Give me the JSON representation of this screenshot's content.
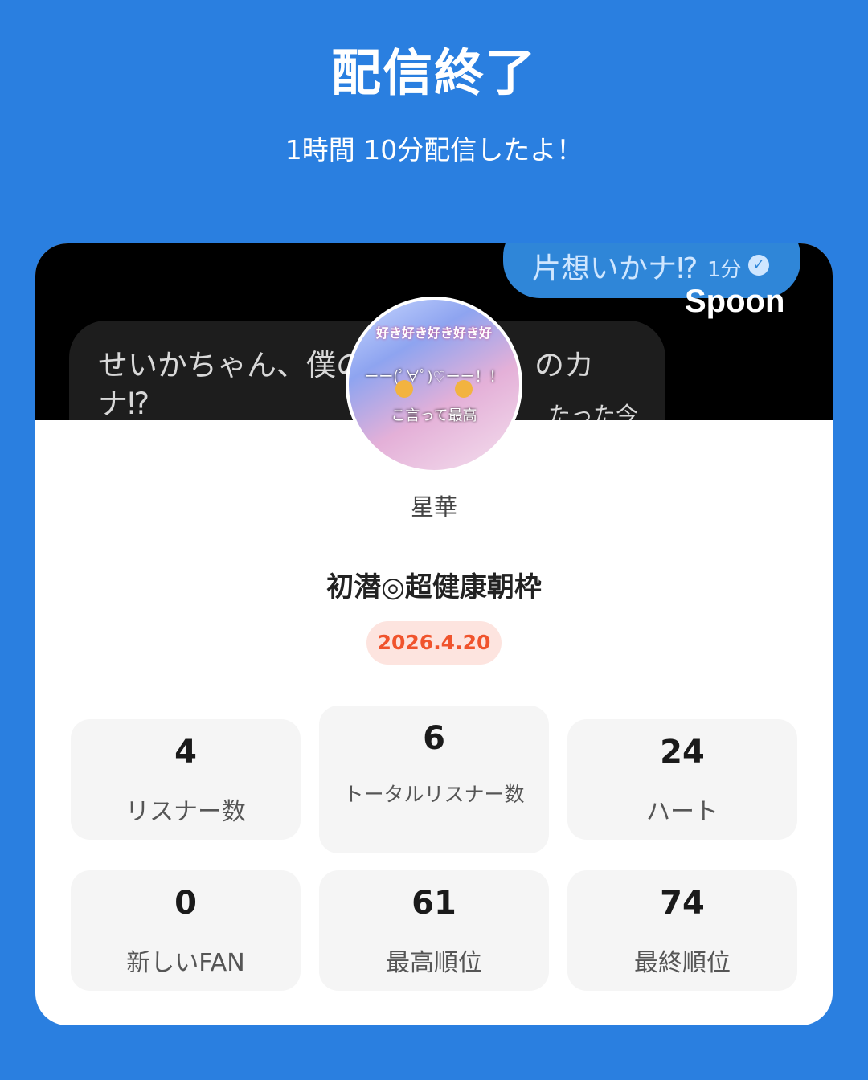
{
  "header": {
    "title": "配信終了",
    "subtitle": "1時間 10分配信したよ！"
  },
  "banner": {
    "bubble_right_text": "片想いかナ⁉",
    "bubble_right_time": "1分",
    "logo": "Spoon",
    "bubble_left_text": "せいかちゃん、僕の",
    "bubble_left_text_tail": "のカ",
    "bubble_left_text_line2": "ナ⁉",
    "bubble_left_time": "たった今"
  },
  "avatar": {
    "overlay_top": "好き好き好き好き好",
    "overlay_mid": "ーー(ﾟ∀ﾟ)♡ーー！！",
    "overlay_bottom": "こ言って最高"
  },
  "profile": {
    "username": "星華"
  },
  "stream": {
    "title": "初潜◎超健康朝枠",
    "date": "2026.4.20"
  },
  "stats": [
    {
      "value": "4",
      "label": "リスナー数"
    },
    {
      "value": "6",
      "label": "トータルリスナー数"
    },
    {
      "value": "24",
      "label": "ハート"
    },
    {
      "value": "0",
      "label": "新しいFAN"
    },
    {
      "value": "61",
      "label": "最高順位"
    },
    {
      "value": "74",
      "label": "最終順位"
    }
  ],
  "colors": {
    "background": "#2a7fe0",
    "card": "#ffffff",
    "badge_bg": "#fde4df",
    "badge_text": "#f0542d"
  }
}
